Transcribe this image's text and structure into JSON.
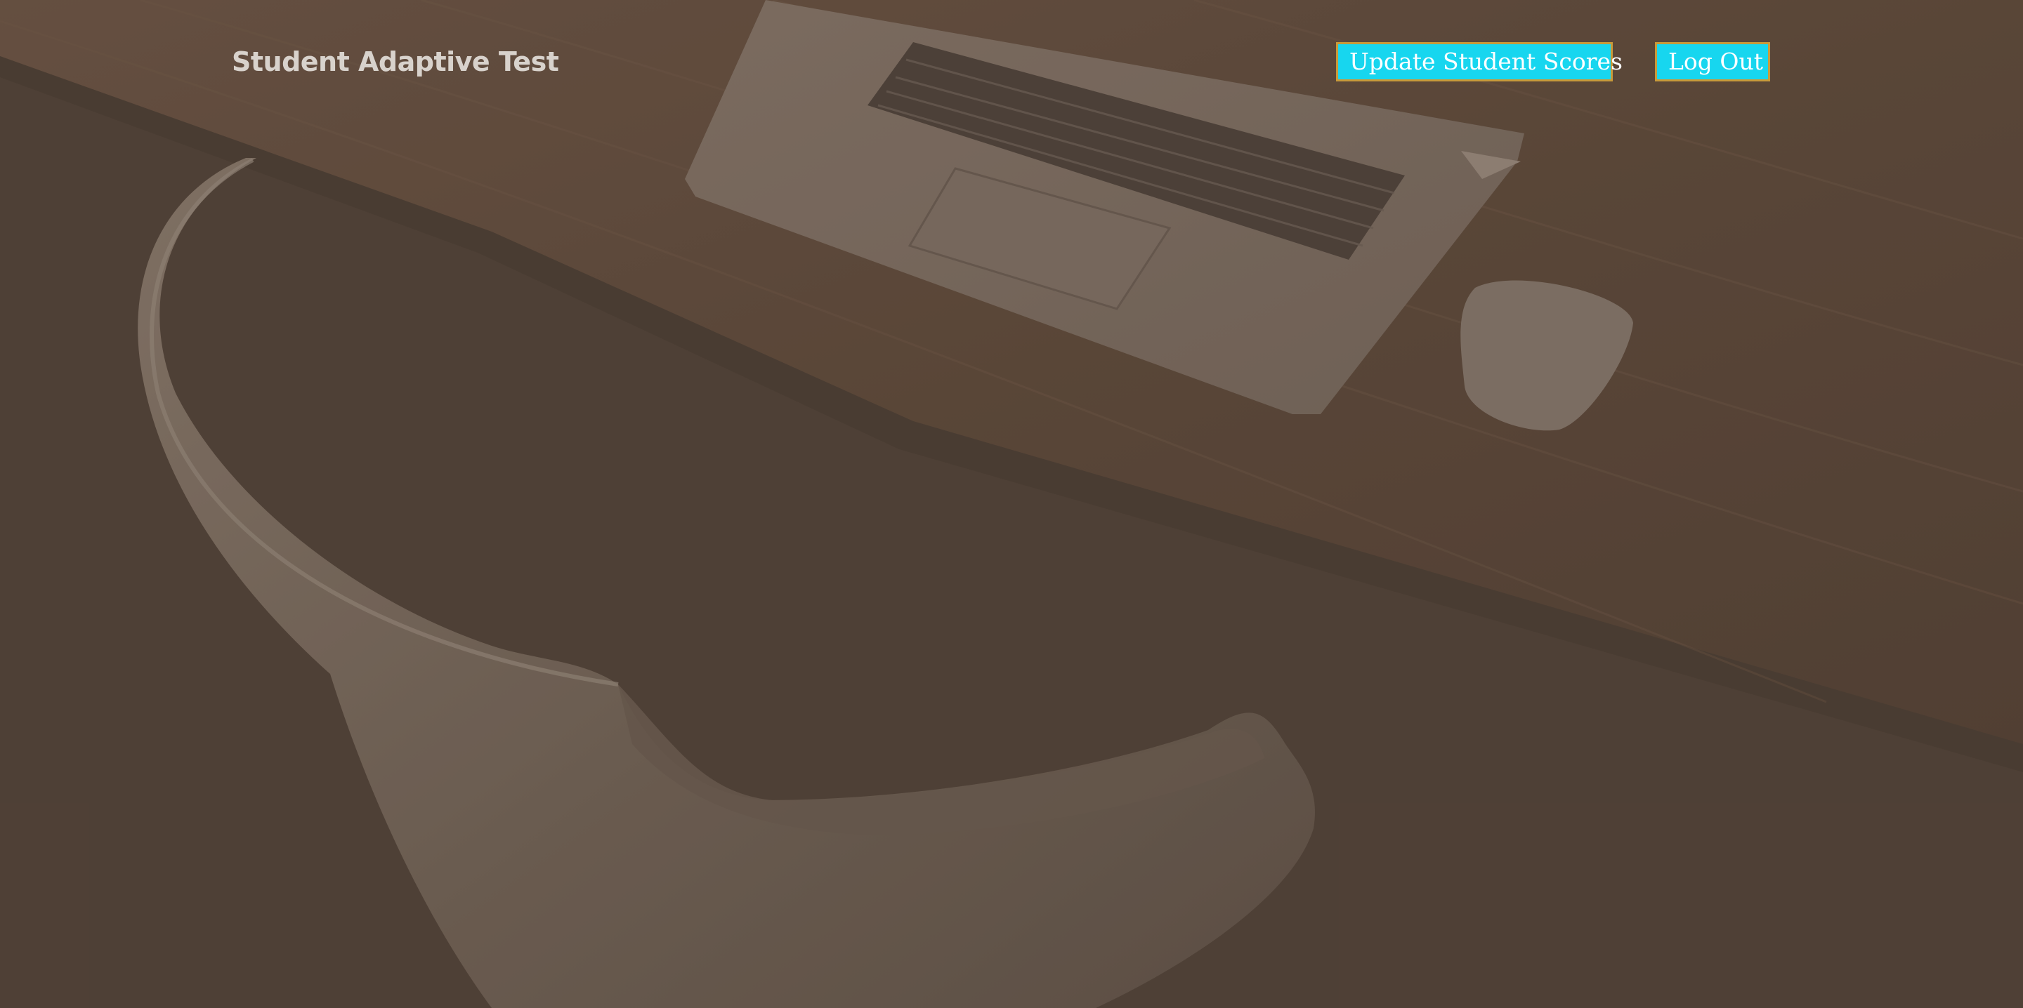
{
  "navbar": {
    "brand": "Student Adaptive Test",
    "update_scores_label": "Update Student Scores",
    "logout_label": "Log Out"
  },
  "colors": {
    "background": "#4e3f35",
    "button_bg": "#17d6ef",
    "button_border": "#c89a3a",
    "button_text": "#ffffff",
    "brand_text": "#d8d2cc"
  },
  "background_image": {
    "icon": "desk-laptop-chair-photo"
  }
}
